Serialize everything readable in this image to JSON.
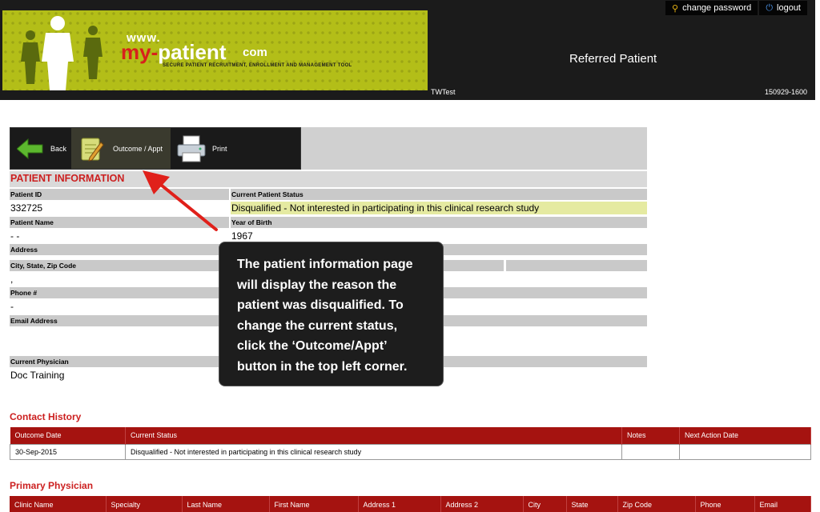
{
  "header": {
    "logo_www": "www.",
    "logo_my": "my-",
    "logo_patient": "patient",
    "logo_com": "com",
    "logo_tagline": "SECURE PATIENT RECRUITMENT, ENROLLMENT AND MANAGEMENT TOOL",
    "change_password": "change password",
    "logout": "logout",
    "page_title": "Referred Patient",
    "user": "TWTest",
    "version": "150929-1600"
  },
  "toolbar": {
    "back_label": "Back",
    "outcome_label": "Outcome / Appt",
    "print_label": "Print"
  },
  "patient_info": {
    "section_title": "PATIENT INFORMATION",
    "patient_id_label": "Patient ID",
    "patient_id": "332725",
    "current_status_label": "Current Patient Status",
    "current_status": "Disqualified - Not interested in participating in this clinical research study",
    "patient_name_label": "Patient Name",
    "patient_name": "- -",
    "year_of_birth_label": "Year of Birth",
    "year_of_birth": "1967",
    "address_label": "Address",
    "city_state_zip_label": "City, State, Zip Code",
    "city_state_zip": ",",
    "phone_label": "Phone #",
    "phone": "-",
    "email_label": "Email Address",
    "physician_label": "Current Physician",
    "physician": "Doc Training"
  },
  "callout": {
    "text": "The patient information page will display the reason the patient was disqualified. To change the current status, click the ‘Outcome/Appt’ button in the top left corner."
  },
  "contact_history": {
    "title": "Contact History",
    "columns": [
      "Outcome Date",
      "Current Status",
      "Notes",
      "Next Action Date"
    ],
    "rows": [
      [
        "30-Sep-2015",
        "Disqualified - Not interested in participating in this clinical research study",
        "",
        ""
      ]
    ]
  },
  "primary_physician": {
    "title": "Primary Physician",
    "columns": [
      "Clinic Name",
      "Specialty",
      "Last Name",
      "First Name",
      "Address 1",
      "Address 2",
      "City",
      "State",
      "Zip Code",
      "Phone",
      "Email"
    ]
  },
  "colors": {
    "header_bg": "#1b1b1b",
    "banner_green": "#b3be18",
    "accent_red": "#cc1f1f",
    "table_header_red": "#a51310",
    "status_highlight": "#e5eaa1"
  }
}
